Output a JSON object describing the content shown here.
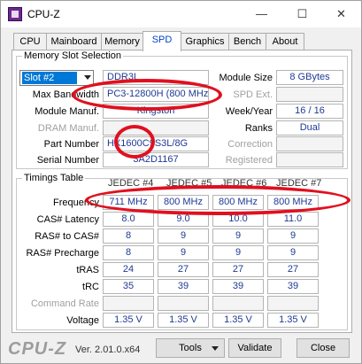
{
  "window": {
    "title": "CPU-Z",
    "minimize": "—",
    "maximize": "☐",
    "close": "✕"
  },
  "tabs": [
    "CPU",
    "Mainboard",
    "Memory",
    "SPD",
    "Graphics",
    "Bench",
    "About"
  ],
  "active_tab": "SPD",
  "memory_slot": {
    "group_title": "Memory Slot Selection",
    "slot": "Slot #2",
    "type": "DDR3L",
    "max_bandwidth_label": "Max Bandwidth",
    "max_bandwidth": "PC3-12800H (800 MHz)",
    "module_manuf_label": "Module Manuf.",
    "module_manuf": "Kingston",
    "dram_manuf_label": "DRAM Manuf.",
    "dram_manuf": "",
    "part_number_label": "Part Number",
    "part_number": "HX1600C9S3L/8G",
    "serial_number_label": "Serial Number",
    "serial_number": "3A2D1167",
    "module_size_label": "Module Size",
    "module_size": "8 GBytes",
    "spd_ext_label": "SPD Ext.",
    "spd_ext": "",
    "week_year_label": "Week/Year",
    "week_year": "16 / 16",
    "ranks_label": "Ranks",
    "ranks": "Dual",
    "correction_label": "Correction",
    "correction": "",
    "registered_label": "Registered",
    "registered": ""
  },
  "timings": {
    "group_title": "Timings Table",
    "columns": [
      "JEDEC #4",
      "JEDEC #5",
      "JEDEC #6",
      "JEDEC #7"
    ],
    "rows": [
      {
        "label": "Frequency",
        "values": [
          "711 MHz",
          "800 MHz",
          "800 MHz",
          "800 MHz"
        ]
      },
      {
        "label": "CAS# Latency",
        "values": [
          "8.0",
          "9.0",
          "10.0",
          "11.0"
        ]
      },
      {
        "label": "RAS# to CAS#",
        "values": [
          "8",
          "9",
          "9",
          "9"
        ]
      },
      {
        "label": "RAS# Precharge",
        "values": [
          "8",
          "9",
          "9",
          "9"
        ]
      },
      {
        "label": "tRAS",
        "values": [
          "24",
          "27",
          "27",
          "27"
        ]
      },
      {
        "label": "tRC",
        "values": [
          "35",
          "39",
          "39",
          "39"
        ]
      },
      {
        "label": "Command Rate",
        "values": [
          "",
          "",
          "",
          ""
        ]
      },
      {
        "label": "Voltage",
        "values": [
          "1.35 V",
          "1.35 V",
          "1.35 V",
          "1.35 V"
        ]
      }
    ]
  },
  "footer": {
    "logo": "CPU-Z",
    "version": "Ver. 2.01.0.x64",
    "tools": "Tools",
    "validate": "Validate",
    "close": "Close"
  }
}
